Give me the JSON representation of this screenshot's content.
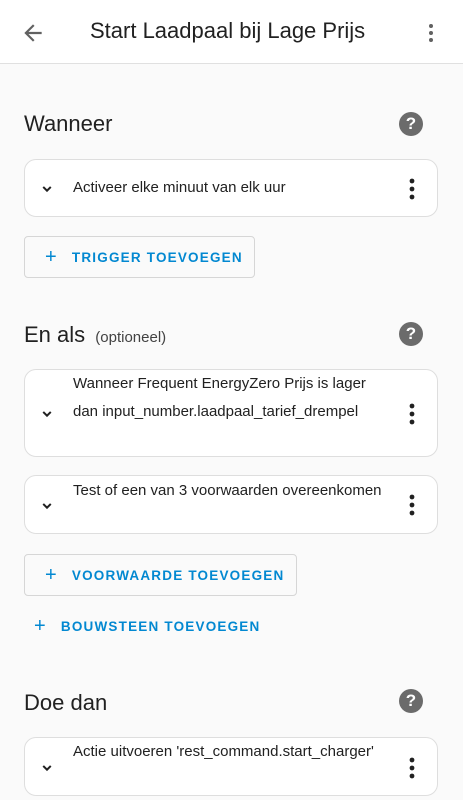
{
  "header": {
    "title": "Start Laadpaal bij Lage Prijs",
    "back_icon": "arrow-left-icon",
    "menu_icon": "dots-vertical-icon"
  },
  "sections": {
    "when": {
      "title": "Wanneer",
      "help": "?",
      "items": [
        {
          "text": "Activeer elke minuut van elk uur"
        }
      ],
      "add_button": "TRIGGER TOEVOEGEN"
    },
    "and_if": {
      "title": "En als",
      "optional": "(optioneel)",
      "help": "?",
      "items": [
        {
          "text": "Wanneer Frequent EnergyZero Prijs is lager dan input_number.laadpaal_tarief_drempel"
        },
        {
          "text": "Test of een van 3 voorwaarden overeenkomen"
        }
      ],
      "add_button": "VOORWAARDE TOEVOEGEN",
      "add_block_button": "BOUWSTEEN TOEVOEGEN"
    },
    "then": {
      "title": "Doe dan",
      "help": "?",
      "items": [
        {
          "text": "Actie uitvoeren 'rest_command.start_charger'"
        }
      ]
    }
  },
  "colors": {
    "accent": "#0288d1",
    "background": "#fafafa",
    "card": "#ffffff",
    "help_icon": "#6b6b6b"
  }
}
